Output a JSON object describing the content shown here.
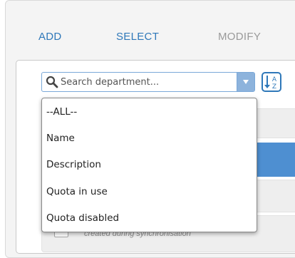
{
  "tabs": {
    "add": "ADD",
    "select": "SELECT",
    "modify": "MODIFY"
  },
  "search": {
    "placeholder": "Search department..."
  },
  "dropdown": {
    "options": [
      "--ALL--",
      "Name",
      "Description",
      "Quota in use",
      "Quota disabled"
    ]
  },
  "list": {
    "partial_subtext": "created during synchronisation"
  },
  "colors": {
    "accent": "#2f78b9",
    "selected_row": "#4e8fd1",
    "disabled_tab": "#9a9a9a"
  },
  "icons": {
    "search": "magnifier-icon",
    "dropdown": "triangle-down-icon",
    "sort": "sort-a-z-icon"
  }
}
